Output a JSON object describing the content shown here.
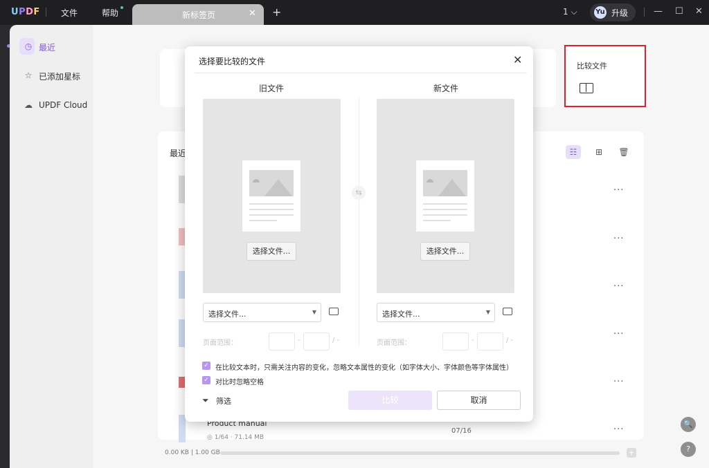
{
  "titlebar": {
    "logo": {
      "u": "U",
      "p": "P",
      "d": "D",
      "f": "F"
    },
    "menu_file": "文件",
    "menu_help": "帮助",
    "tab_label": "新标签页",
    "tab_close": "✕",
    "tab_add": "+",
    "page_count": "1 ⌵",
    "avatar_initials": "Yu",
    "upgrade_label": "升级",
    "win_min": "—",
    "win_max": "☐",
    "win_close": "✕"
  },
  "sidebar": {
    "items": [
      {
        "label": "最近",
        "icon": "clock-icon"
      },
      {
        "label": "已添加星标",
        "icon": "star-icon"
      },
      {
        "label": "UPDF Cloud",
        "icon": "cloud-icon"
      }
    ]
  },
  "home": {
    "compare_card_label": "比较文件",
    "recent_title": "最近",
    "product_name": "Product manual",
    "product_meta": "◎ 1/64 · 71.14 MB",
    "product_date": "07/16",
    "storage_text": "0.00 KB | 1.00 GB",
    "more": "···",
    "search_float": "🔍",
    "help_float": "?"
  },
  "dialog": {
    "title": "选择要比较的文件",
    "close": "✕",
    "old_title": "旧文件",
    "new_title": "新文件",
    "choose_btn": "选择文件...",
    "select_value": "选择文件...",
    "caret": "▼",
    "swap": "⇆",
    "range_label": "页面范围：",
    "range_dash": "-",
    "range_slash": "/ -",
    "option1": "在比较文本时，只需关注内容的变化，忽略文本属性的变化（如字体大小、字体颜色等字体属性）",
    "option2": "对比时忽略空格",
    "check": "✓",
    "filter_label": "筛选",
    "filter_icon": "⏷",
    "compare_btn": "比较",
    "cancel_btn": "取消"
  }
}
